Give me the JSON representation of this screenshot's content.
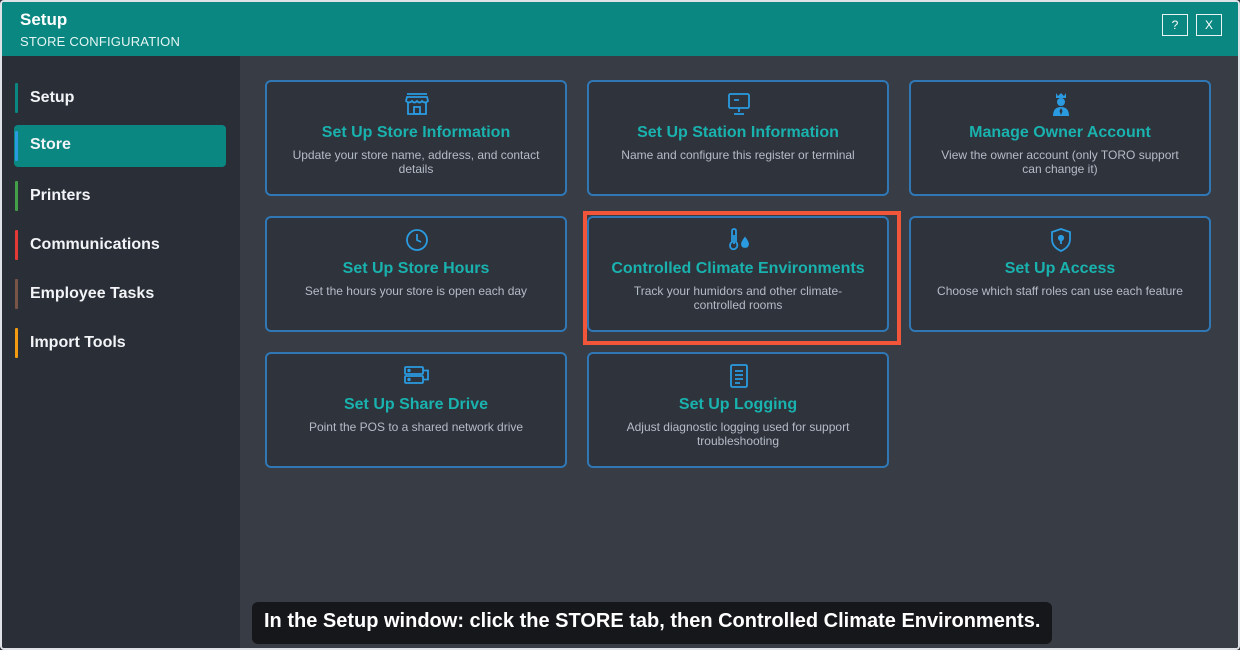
{
  "window": {
    "title": "Setup",
    "subtitle": "STORE CONFIGURATION",
    "help_label": "?",
    "close_label": "X"
  },
  "sidebar": {
    "items": [
      {
        "label": "Setup",
        "color": "#0b8781",
        "active": false
      },
      {
        "label": "Store",
        "color": "#2a9be0",
        "active": true
      },
      {
        "label": "Printers",
        "color": "#43a048",
        "active": false
      },
      {
        "label": "Communications",
        "color": "#e53935",
        "active": false
      },
      {
        "label": "Employee Tasks",
        "color": "#795548",
        "active": false
      },
      {
        "label": "Import Tools",
        "color": "#f39c12",
        "active": false
      }
    ]
  },
  "cards": [
    {
      "icon": "storefront-icon",
      "title": "Set Up Store Information",
      "desc": "Update your store name, address, and contact details"
    },
    {
      "icon": "monitor-icon",
      "title": "Set Up Station Information",
      "desc": "Name and configure this register or terminal"
    },
    {
      "icon": "owner-crown-icon",
      "title": "Manage Owner Account",
      "desc": "View the owner account (only TORO support can change it)"
    },
    {
      "icon": "clock-icon",
      "title": "Set Up Store Hours",
      "desc": "Set the hours your store is open each day"
    },
    {
      "icon": "thermometer-droplet-icon",
      "title": "Controlled Climate Environments",
      "desc": "Track your humidors and other climate-controlled rooms"
    },
    {
      "icon": "shield-icon",
      "title": "Set Up Access",
      "desc": "Choose which staff roles can use each feature"
    },
    {
      "icon": "network-drive-icon",
      "title": "Set Up Share Drive",
      "desc": "Point the POS to a shared network drive"
    },
    {
      "icon": "document-icon",
      "title": "Set Up Logging",
      "desc": "Adjust diagnostic logging used for support troubleshooting"
    }
  ],
  "caption": "In the Setup window: click the STORE tab, then Controlled Climate Environments.",
  "colors": {
    "accent": "#0b8781",
    "card_border": "#2f78b5",
    "card_title": "#19b2ae",
    "highlight": "#f1553a"
  }
}
